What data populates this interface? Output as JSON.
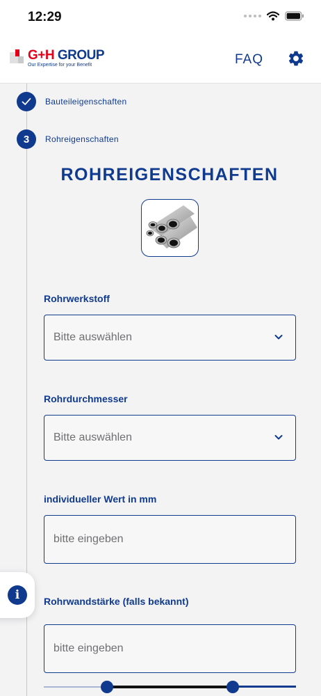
{
  "status_bar": {
    "time": "12:29"
  },
  "header": {
    "logo_gh": "G+H",
    "logo_group": "GROUP",
    "logo_tagline": "Our Expertise for your Benefit",
    "faq_label": "FAQ"
  },
  "steps": [
    {
      "marker": "",
      "label": "Bauteileigenschaften",
      "state": "completed"
    },
    {
      "marker": "3",
      "label": "Rohreigenschaften",
      "state": "active"
    }
  ],
  "main": {
    "title": "ROHREIGENSCHAFTEN",
    "image_icon": "pipes-image"
  },
  "form": {
    "material": {
      "label": "Rohrwerkstoff",
      "value": "Bitte auswählen"
    },
    "diameter": {
      "label": "Rohrdurchmesser",
      "value": "Bitte auswählen"
    },
    "custom_value": {
      "label": "individueller Wert in mm",
      "placeholder": "bitte eingeben"
    },
    "wall_thickness": {
      "label": "Rohrwandstärke (falls bekannt)",
      "placeholder": "bitte eingeben"
    }
  },
  "slider": {
    "low_fraction": 0.25,
    "high_fraction": 0.75
  },
  "colors": {
    "primary": "#0f3a8e",
    "brand_red": "#e2001a",
    "background": "#f3f3f4"
  }
}
